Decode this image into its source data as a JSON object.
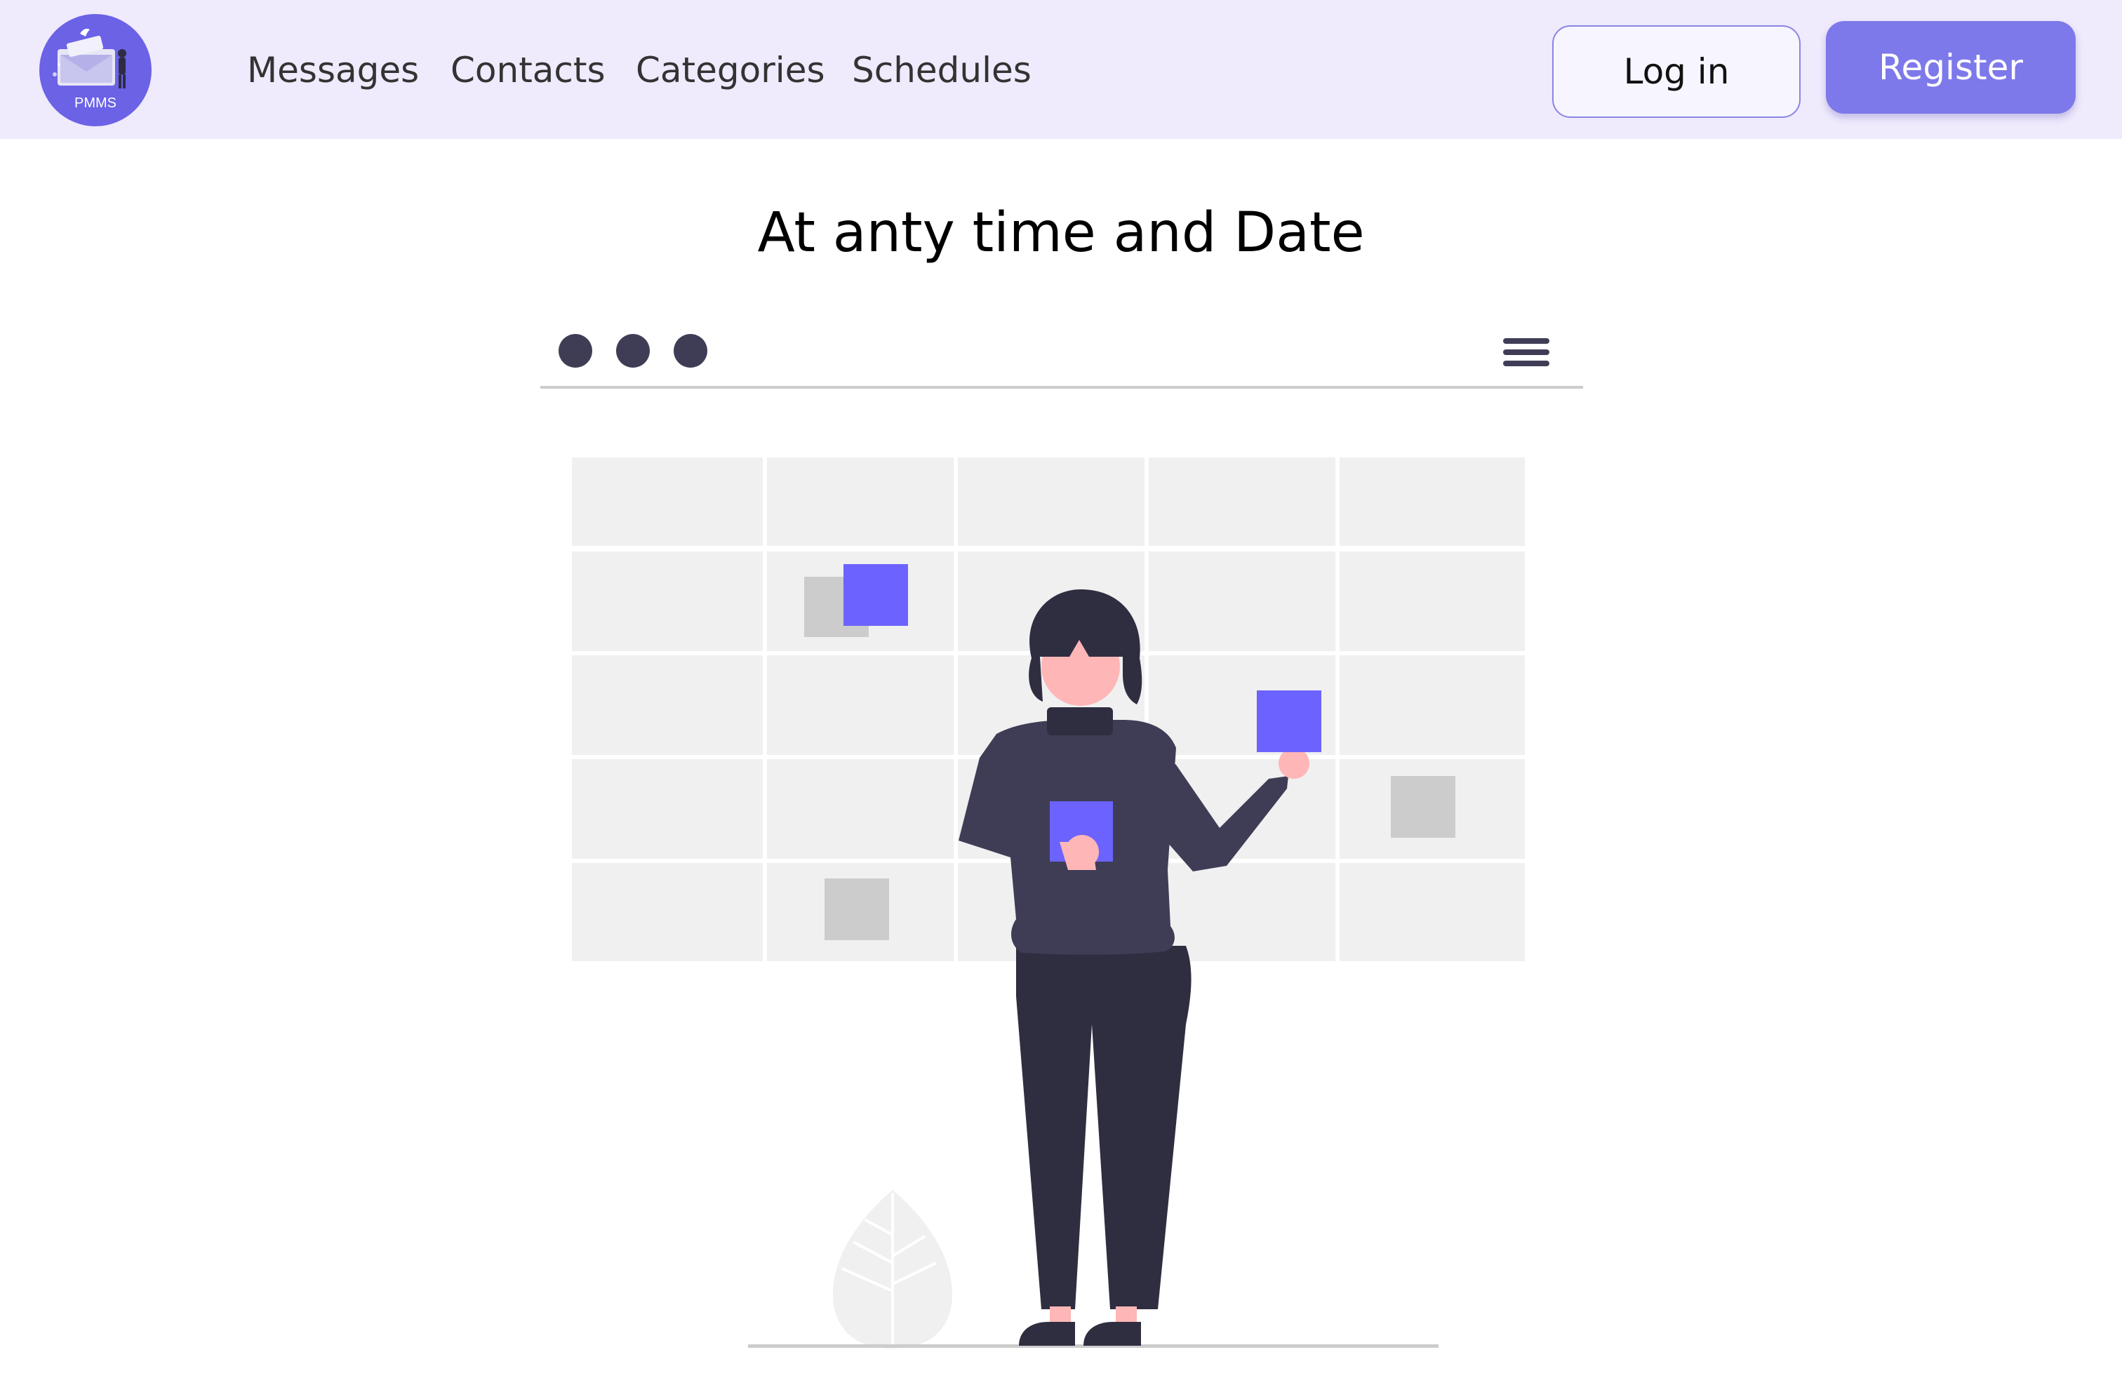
{
  "header": {
    "logo_text": "PMMS",
    "nav": [
      {
        "label": "Messages"
      },
      {
        "label": "Contacts"
      },
      {
        "label": "Categories"
      },
      {
        "label": "Schedules"
      }
    ],
    "login_label": "Log in",
    "register_label": "Register"
  },
  "main": {
    "title": "At anty time and Date"
  },
  "colors": {
    "navbar_bg": "#efeafc",
    "accent": "#6c63ff",
    "register_button": "#7d79ea",
    "figure_dark": "#3f3d56"
  },
  "icons": [
    "window-dots-icon",
    "hamburger-menu-icon",
    "calendar-grid",
    "person-illustration",
    "leaf-plant-icon"
  ]
}
